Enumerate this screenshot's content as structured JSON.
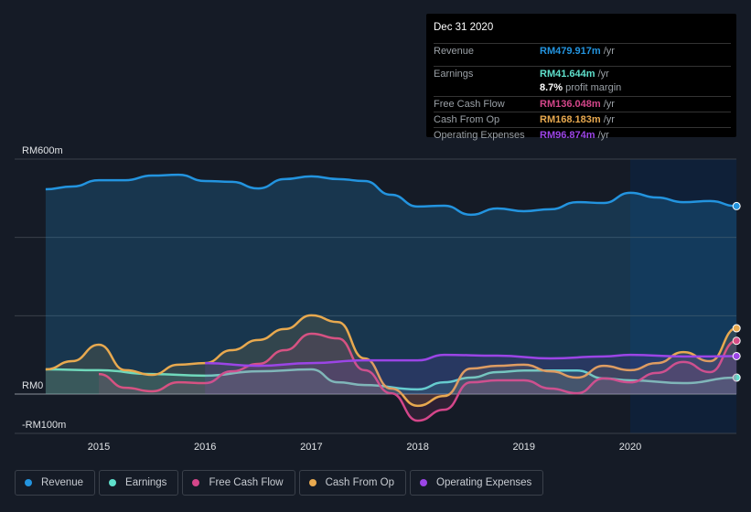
{
  "tooltip": {
    "date": "Dec 31 2020",
    "rows": [
      {
        "label": "Revenue",
        "value": "RM479.917m",
        "unit": " /yr",
        "color": "#2394df"
      },
      {
        "label": "Earnings",
        "value": "RM41.644m",
        "unit": " /yr",
        "color": "#5fe0cc"
      },
      {
        "label": "",
        "value": "8.7%",
        "unit": " profit margin",
        "color": "#ffffff"
      },
      {
        "label": "Free Cash Flow",
        "value": "RM136.048m",
        "unit": " /yr",
        "color": "#d4468a"
      },
      {
        "label": "Cash From Op",
        "value": "RM168.183m",
        "unit": " /yr",
        "color": "#e8a94f"
      },
      {
        "label": "Operating Expenses",
        "value": "RM96.874m",
        "unit": " /yr",
        "color": "#9b45e6"
      }
    ]
  },
  "legend": [
    {
      "label": "Revenue",
      "color": "#2394df"
    },
    {
      "label": "Earnings",
      "color": "#5fe0cc"
    },
    {
      "label": "Free Cash Flow",
      "color": "#d4468a"
    },
    {
      "label": "Cash From Op",
      "color": "#e8a94f"
    },
    {
      "label": "Operating Expenses",
      "color": "#9b45e6"
    }
  ],
  "chart_data": {
    "type": "area",
    "ylim": [
      -100,
      600
    ],
    "y_tick_labels": [
      "RM600m",
      "RM0",
      "-RM100m"
    ],
    "y_ticks": [
      600,
      0,
      -100
    ],
    "x_ticks": [
      2015,
      2016,
      2017,
      2018,
      2019,
      2020
    ],
    "x_tick_labels": [
      "2015",
      "2016",
      "2017",
      "2018",
      "2019",
      "2020"
    ],
    "highlight_range": [
      2020,
      2021
    ],
    "grid": true,
    "legend_placement": "bottom",
    "series": [
      {
        "name": "Revenue",
        "color": "#2394df",
        "x": [
          2014.5,
          2014.75,
          2015,
          2015.25,
          2015.5,
          2015.75,
          2016,
          2016.25,
          2016.5,
          2016.75,
          2017,
          2017.25,
          2017.5,
          2017.75,
          2018,
          2018.25,
          2018.5,
          2018.75,
          2019,
          2019.25,
          2019.5,
          2019.75,
          2020,
          2020.25,
          2020.5,
          2020.75,
          2021
        ],
        "values": [
          523,
          530,
          546,
          546,
          558,
          560,
          544,
          542,
          525,
          549,
          556,
          549,
          544,
          509,
          479,
          481,
          458,
          474,
          467,
          472,
          490,
          488,
          514,
          502,
          490,
          493,
          480
        ]
      },
      {
        "name": "Earnings",
        "color": "#5fe0cc",
        "x": [
          2014.5,
          2015,
          2015.5,
          2016,
          2016.5,
          2017,
          2017.25,
          2017.5,
          2018,
          2018.25,
          2018.5,
          2018.75,
          2019,
          2019.5,
          2019.75,
          2020,
          2020.5,
          2021
        ],
        "values": [
          63,
          61,
          51,
          47,
          58,
          63,
          30,
          23,
          12,
          30,
          42,
          56,
          60,
          60,
          40,
          35,
          28,
          42
        ]
      },
      {
        "name": "Free Cash Flow",
        "color": "#d4468a",
        "x": [
          2015,
          2015.25,
          2015.5,
          2015.75,
          2016,
          2016.25,
          2016.5,
          2016.75,
          2017,
          2017.25,
          2017.5,
          2017.75,
          2018,
          2018.25,
          2018.5,
          2018.75,
          2019,
          2019.25,
          2019.5,
          2019.75,
          2020,
          2020.25,
          2020.5,
          2020.75,
          2021
        ],
        "values": [
          51,
          16,
          7,
          30,
          28,
          58,
          77,
          112,
          154,
          142,
          61,
          2,
          -68,
          -40,
          30,
          35,
          35,
          14,
          2,
          40,
          30,
          54,
          82,
          56,
          136
        ]
      },
      {
        "name": "Cash From Op",
        "color": "#e8a94f",
        "x": [
          2014.5,
          2014.75,
          2015,
          2015.25,
          2015.5,
          2015.75,
          2016,
          2016.25,
          2016.5,
          2016.75,
          2017,
          2017.25,
          2017.5,
          2017.75,
          2018,
          2018.25,
          2018.5,
          2018.75,
          2019,
          2019.25,
          2019.5,
          2019.75,
          2020,
          2020.25,
          2020.5,
          2020.75,
          2021
        ],
        "values": [
          63,
          84,
          126,
          61,
          49,
          75,
          79,
          112,
          138,
          166,
          201,
          184,
          91,
          14,
          -30,
          -5,
          65,
          72,
          75,
          58,
          42,
          72,
          61,
          79,
          107,
          84,
          168
        ]
      },
      {
        "name": "Operating Expenses",
        "color": "#9b45e6",
        "x": [
          2016,
          2016.5,
          2017,
          2017.5,
          2018,
          2018.25,
          2018.75,
          2019.25,
          2019.75,
          2020,
          2020.5,
          2020.75,
          2021
        ],
        "values": [
          79,
          72,
          79,
          86,
          86,
          100,
          98,
          91,
          96,
          100,
          96,
          96,
          97
        ]
      }
    ]
  }
}
